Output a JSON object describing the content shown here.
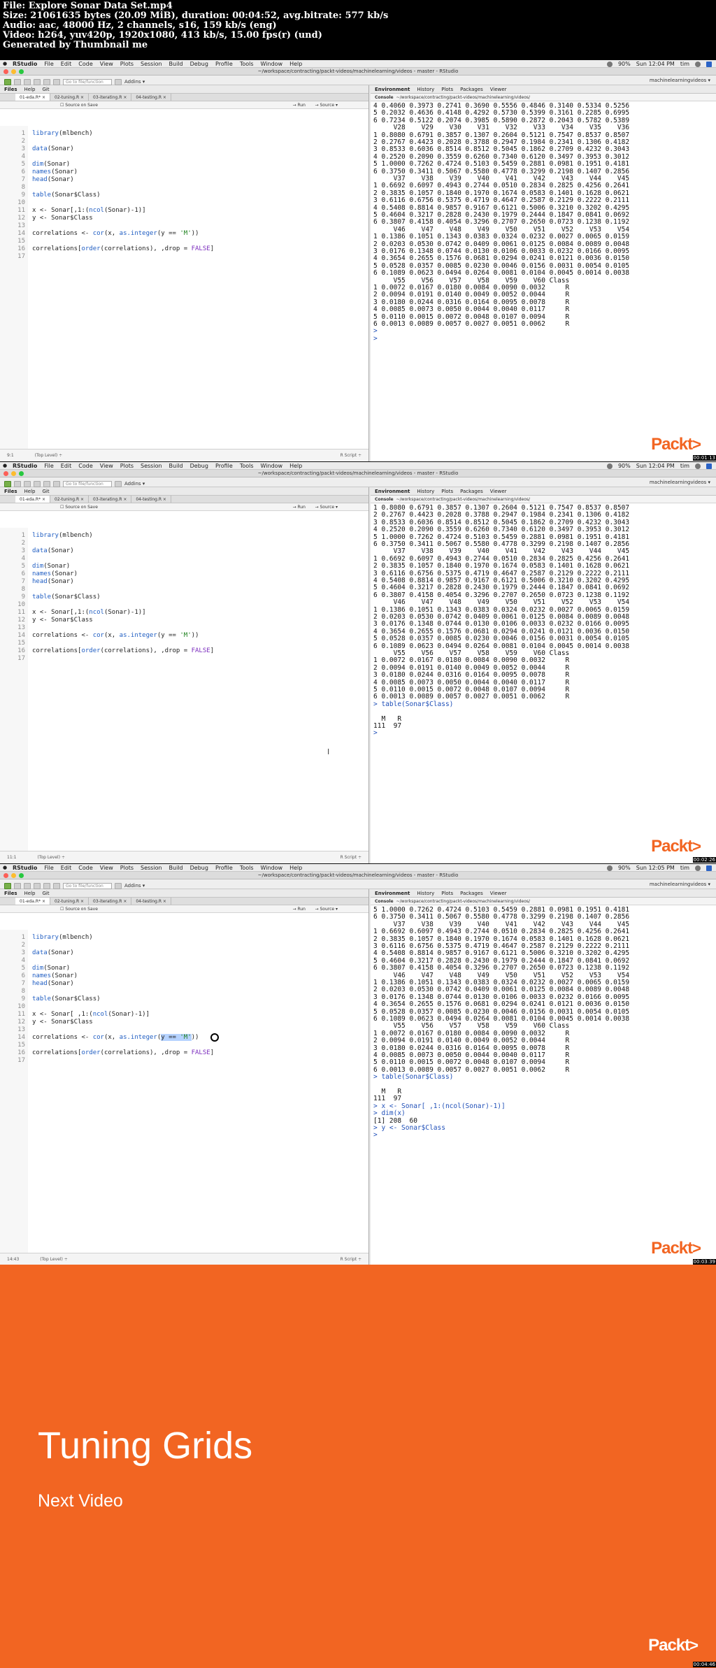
{
  "header": {
    "lines": [
      "File: Explore Sonar Data Set.mp4",
      "Size: 21061635 bytes (20.09 MiB), duration: 00:04:52, avg.bitrate: 577 kb/s",
      "Audio: aac, 48000 Hz, 2 channels, s16, 159 kb/s (eng)",
      "Video: h264, yuv420p, 1920x1080, 413 kb/s, 15.00 fps(r) (und)",
      "Generated by Thumbnail me"
    ]
  },
  "app": {
    "name": "RStudio",
    "menus": [
      "RStudio",
      "File",
      "Edit",
      "Code",
      "View",
      "Plots",
      "Session",
      "Build",
      "Debug",
      "Profile",
      "Tools",
      "Window",
      "Help"
    ],
    "window_title": "~/workspace/contracting/packt-videos/machinelearning/videos - master - RStudio",
    "goto_placeholder": "Go to file/function",
    "addins": "Addins",
    "project": "machinelearningvideos",
    "left_tabs": [
      "Files",
      "Help",
      "Git"
    ],
    "editor_tabs": [
      "01-eda.R",
      "02-tuning.R",
      "03-iterating.R",
      "04-testing.R"
    ],
    "source_on_save": "Source on Save",
    "run": "Run",
    "source": "Source",
    "status_toplevel": "(Top Level)",
    "status_rscript": "R Script",
    "right_tabs": [
      "Environment",
      "History",
      "Plots",
      "Packages",
      "Viewer"
    ],
    "console_label": "Console",
    "console_path": "~/workspace/contracting/packt-videos/machinelearning/videos/",
    "battery": "90%",
    "user": "tim"
  },
  "frames": [
    {
      "clock": "Sun 12:04 PM",
      "cursor_pos": "9:1",
      "timestamp": "00:01:13",
      "code": [
        "library(mlbench)",
        "",
        "data(Sonar)",
        "",
        "dim(Sonar)",
        "names(Sonar)",
        "head(Sonar)",
        "",
        "table(Sonar$Class)",
        "",
        "x <- Sonar[,1:(ncol(Sonar)-1)]",
        "y <- Sonar$Class",
        "",
        "correlations <- cor(x, as.integer(y == 'M'))",
        "",
        "correlations[order(correlations), ,drop = FALSE]",
        ""
      ],
      "console": [
        "4 0.4060 0.3973 0.2741 0.3690 0.5556 0.4846 0.3140 0.5334 0.5256",
        "5 0.2032 0.4636 0.4148 0.4292 0.5730 0.5399 0.3161 0.2285 0.6995",
        "6 0.7234 0.5122 0.2074 0.3985 0.5890 0.2872 0.2043 0.5782 0.5389",
        "     V28    V29    V30    V31    V32    V33    V34    V35    V36",
        "1 0.8080 0.6791 0.3857 0.1307 0.2604 0.5121 0.7547 0.8537 0.8507",
        "2 0.2767 0.4423 0.2028 0.3788 0.2947 0.1984 0.2341 0.1306 0.4182",
        "3 0.8533 0.6036 0.8514 0.8512 0.5045 0.1862 0.2709 0.4232 0.3043",
        "4 0.2520 0.2090 0.3559 0.6260 0.7340 0.6120 0.3497 0.3953 0.3012",
        "5 1.0000 0.7262 0.4724 0.5103 0.5459 0.2881 0.0981 0.1951 0.4181",
        "6 0.3750 0.3411 0.5067 0.5580 0.4778 0.3299 0.2198 0.1407 0.2856",
        "     V37    V38    V39    V40    V41    V42    V43    V44    V45",
        "1 0.6692 0.6097 0.4943 0.2744 0.0510 0.2834 0.2825 0.4256 0.2641",
        "2 0.3835 0.1057 0.1840 0.1970 0.1674 0.0583 0.1401 0.1628 0.0621",
        "3 0.6116 0.6756 0.5375 0.4719 0.4647 0.2587 0.2129 0.2222 0.2111",
        "4 0.5408 0.8814 0.9857 0.9167 0.6121 0.5006 0.3210 0.3202 0.4295",
        "5 0.4604 0.3217 0.2828 0.2430 0.1979 0.2444 0.1847 0.0841 0.0692",
        "6 0.3807 0.4158 0.4054 0.3296 0.2707 0.2650 0.0723 0.1238 0.1192",
        "     V46    V47    V48    V49    V50    V51    V52    V53    V54",
        "1 0.1386 0.1051 0.1343 0.0383 0.0324 0.0232 0.0027 0.0065 0.0159",
        "2 0.0203 0.0530 0.0742 0.0409 0.0061 0.0125 0.0084 0.0089 0.0048",
        "3 0.0176 0.1348 0.0744 0.0130 0.0106 0.0033 0.0232 0.0166 0.0095",
        "4 0.3654 0.2655 0.1576 0.0681 0.0294 0.0241 0.0121 0.0036 0.0150",
        "5 0.0528 0.0357 0.0085 0.0230 0.0046 0.0156 0.0031 0.0054 0.0105",
        "6 0.1089 0.0623 0.0494 0.0264 0.0081 0.0104 0.0045 0.0014 0.0038",
        "     V55    V56    V57    V58    V59    V60 Class",
        "1 0.0072 0.0167 0.0180 0.0084 0.0090 0.0032     R",
        "2 0.0094 0.0191 0.0140 0.0049 0.0052 0.0044     R",
        "3 0.0180 0.0244 0.0316 0.0164 0.0095 0.0078     R",
        "4 0.0085 0.0073 0.0050 0.0044 0.0040 0.0117     R",
        "5 0.0110 0.0015 0.0072 0.0048 0.0107 0.0094     R",
        "6 0.0013 0.0089 0.0057 0.0027 0.0051 0.0062     R",
        "> ",
        ">"
      ]
    },
    {
      "clock": "Sun 12:04 PM",
      "cursor_pos": "11:1",
      "timestamp": "00:02:26",
      "code": [
        "library(mlbench)",
        "",
        "data(Sonar)",
        "",
        "dim(Sonar)",
        "names(Sonar)",
        "head(Sonar)",
        "",
        "table(Sonar$Class)",
        "",
        "x <- Sonar[,1:(ncol(Sonar)-1)]",
        "y <- Sonar$Class",
        "",
        "correlations <- cor(x, as.integer(y == 'M'))",
        "",
        "correlations[order(correlations), ,drop = FALSE]",
        ""
      ],
      "console": [
        "1 0.8080 0.6791 0.3857 0.1307 0.2604 0.5121 0.7547 0.8537 0.8507",
        "2 0.2767 0.4423 0.2028 0.3788 0.2947 0.1984 0.2341 0.1306 0.4182",
        "3 0.8533 0.6036 0.8514 0.8512 0.5045 0.1862 0.2709 0.4232 0.3043",
        "4 0.2520 0.2090 0.3559 0.6260 0.7340 0.6120 0.3497 0.3953 0.3012",
        "5 1.0000 0.7262 0.4724 0.5103 0.5459 0.2881 0.0981 0.1951 0.4181",
        "6 0.3750 0.3411 0.5067 0.5580 0.4778 0.3299 0.2198 0.1407 0.2856",
        "     V37    V38    V39    V40    V41    V42    V43    V44    V45",
        "1 0.6692 0.6097 0.4943 0.2744 0.0510 0.2834 0.2825 0.4256 0.2641",
        "2 0.3835 0.1057 0.1840 0.1970 0.1674 0.0583 0.1401 0.1628 0.0621",
        "3 0.6116 0.6756 0.5375 0.4719 0.4647 0.2587 0.2129 0.2222 0.2111",
        "4 0.5408 0.8814 0.9857 0.9167 0.6121 0.5006 0.3210 0.3202 0.4295",
        "5 0.4604 0.3217 0.2828 0.2430 0.1979 0.2444 0.1847 0.0841 0.0692",
        "6 0.3807 0.4158 0.4054 0.3296 0.2707 0.2650 0.0723 0.1238 0.1192",
        "     V46    V47    V48    V49    V50    V51    V52    V53    V54",
        "1 0.1386 0.1051 0.1343 0.0383 0.0324 0.0232 0.0027 0.0065 0.0159",
        "2 0.0203 0.0530 0.0742 0.0409 0.0061 0.0125 0.0084 0.0089 0.0048",
        "3 0.0176 0.1348 0.0744 0.0130 0.0106 0.0033 0.0232 0.0166 0.0095",
        "4 0.3654 0.2655 0.1576 0.0681 0.0294 0.0241 0.0121 0.0036 0.0150",
        "5 0.0528 0.0357 0.0085 0.0230 0.0046 0.0156 0.0031 0.0054 0.0105",
        "6 0.1089 0.0623 0.0494 0.0264 0.0081 0.0104 0.0045 0.0014 0.0038",
        "     V55    V56    V57    V58    V59    V60 Class",
        "1 0.0072 0.0167 0.0180 0.0084 0.0090 0.0032     R",
        "2 0.0094 0.0191 0.0140 0.0049 0.0052 0.0044     R",
        "3 0.0180 0.0244 0.0316 0.0164 0.0095 0.0078     R",
        "4 0.0085 0.0073 0.0050 0.0044 0.0040 0.0117     R",
        "5 0.0110 0.0015 0.0072 0.0048 0.0107 0.0094     R",
        "6 0.0013 0.0089 0.0057 0.0027 0.0051 0.0062     R",
        "> table(Sonar$Class)",
        "",
        "  M   R",
        "111  97",
        "> "
      ]
    },
    {
      "clock": "Sun 12:05 PM",
      "cursor_pos": "14:43",
      "timestamp": "00:03:39",
      "code": [
        "library(mlbench)",
        "",
        "data(Sonar)",
        "",
        "dim(Sonar)",
        "names(Sonar)",
        "head(Sonar)",
        "",
        "table(Sonar$Class)",
        "",
        "x <- Sonar[ ,1:(ncol(Sonar)-1)]",
        "y <- Sonar$Class",
        "",
        "correlations <- cor(x, as.integer(y == 'M'))",
        "",
        "correlations[order(correlations), ,drop = FALSE]",
        ""
      ],
      "console": [
        "5 1.0000 0.7262 0.4724 0.5103 0.5459 0.2881 0.0981 0.1951 0.4181",
        "6 0.3750 0.3411 0.5067 0.5580 0.4778 0.3299 0.2198 0.1407 0.2856",
        "     V37    V38    V39    V40    V41    V42    V43    V44    V45",
        "1 0.6692 0.6097 0.4943 0.2744 0.0510 0.2834 0.2825 0.4256 0.2641",
        "2 0.3835 0.1057 0.1840 0.1970 0.1674 0.0583 0.1401 0.1628 0.0621",
        "3 0.6116 0.6756 0.5375 0.4719 0.4647 0.2587 0.2129 0.2222 0.2111",
        "4 0.5408 0.8814 0.9857 0.9167 0.6121 0.5006 0.3210 0.3202 0.4295",
        "5 0.4604 0.3217 0.2828 0.2430 0.1979 0.2444 0.1847 0.0841 0.0692",
        "6 0.3807 0.4158 0.4054 0.3296 0.2707 0.2650 0.0723 0.1238 0.1192",
        "     V46    V47    V48    V49    V50    V51    V52    V53    V54",
        "1 0.1386 0.1051 0.1343 0.0383 0.0324 0.0232 0.0027 0.0065 0.0159",
        "2 0.0203 0.0530 0.0742 0.0409 0.0061 0.0125 0.0084 0.0089 0.0048",
        "3 0.0176 0.1348 0.0744 0.0130 0.0106 0.0033 0.0232 0.0166 0.0095",
        "4 0.3654 0.2655 0.1576 0.0681 0.0294 0.0241 0.0121 0.0036 0.0150",
        "5 0.0528 0.0357 0.0085 0.0230 0.0046 0.0156 0.0031 0.0054 0.0105",
        "6 0.1089 0.0623 0.0494 0.0264 0.0081 0.0104 0.0045 0.0014 0.0038",
        "     V55    V56    V57    V58    V59    V60 Class",
        "1 0.0072 0.0167 0.0180 0.0084 0.0090 0.0032     R",
        "2 0.0094 0.0191 0.0140 0.0049 0.0052 0.0044     R",
        "3 0.0180 0.0244 0.0316 0.0164 0.0095 0.0078     R",
        "4 0.0085 0.0073 0.0050 0.0044 0.0040 0.0117     R",
        "5 0.0110 0.0015 0.0072 0.0048 0.0107 0.0094     R",
        "6 0.0013 0.0089 0.0057 0.0027 0.0051 0.0062     R",
        "> table(Sonar$Class)",
        "",
        "  M   R",
        "111  97",
        "> x <- Sonar[ ,1:(ncol(Sonar)-1)]",
        "> dim(x)",
        "[1] 208  60",
        "> y <- Sonar$Class",
        "> "
      ]
    }
  ],
  "slide": {
    "title": "Tuning Grids",
    "subtitle": "Next Video",
    "timestamp": "00:04:46"
  },
  "brand": {
    "packt": "Packt",
    "chevron": ">",
    "accent": "#f26522"
  }
}
